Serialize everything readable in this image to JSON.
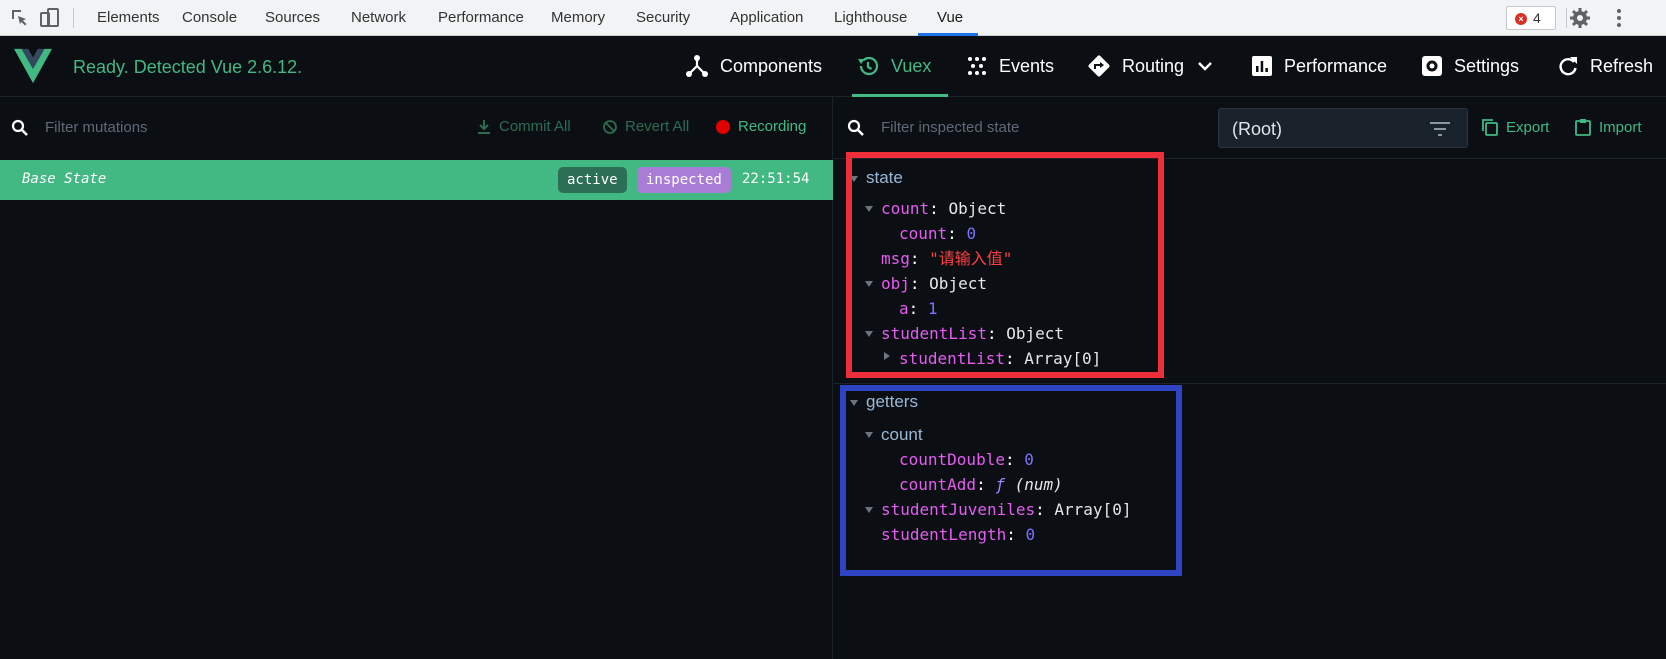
{
  "devtools": {
    "tabs": [
      "Elements",
      "Console",
      "Sources",
      "Network",
      "Performance",
      "Memory",
      "Security",
      "Application",
      "Lighthouse",
      "Vue"
    ],
    "active_tab": "Vue",
    "error_count": "4"
  },
  "vue_header": {
    "status": "Ready. Detected Vue 2.6.12.",
    "nav": {
      "components": "Components",
      "vuex": "Vuex",
      "events": "Events",
      "routing": "Routing",
      "performance": "Performance",
      "settings": "Settings",
      "refresh": "Refresh"
    },
    "active_nav": "Vuex"
  },
  "left_pane": {
    "filter_placeholder": "Filter mutations",
    "commit_all": "Commit All",
    "revert_all": "Revert All",
    "recording": "Recording",
    "rows": [
      {
        "label": "Base State",
        "badges": [
          "active",
          "inspected"
        ],
        "time": "22:51:54"
      }
    ]
  },
  "right_pane": {
    "filter_placeholder": "Filter inspected state",
    "root_select": "(Root)",
    "export": "Export",
    "import": "Import",
    "state": {
      "title": "state",
      "lines": [
        {
          "key": "count",
          "value": "Object"
        },
        {
          "key": "count",
          "value": "0"
        },
        {
          "key": "msg",
          "value": "\"请输入值\""
        },
        {
          "key": "obj",
          "value": "Object"
        },
        {
          "key": "a",
          "value": "1"
        },
        {
          "key": "studentList",
          "value": "Object"
        },
        {
          "key": "studentList",
          "value": "Array[0]"
        }
      ]
    },
    "getters": {
      "title": "getters",
      "group": "count",
      "lines": [
        {
          "key": "countDouble",
          "value": "0"
        },
        {
          "key": "countAdd",
          "fn_symbol": "ƒ",
          "value": "(num)"
        },
        {
          "key": "studentJuveniles",
          "value": "Array[0]"
        },
        {
          "key": "studentLength",
          "value": "0"
        }
      ]
    }
  },
  "colors": {
    "vue_green": "#42b883",
    "background": "#0b0f14",
    "highlight_red": "#ee2f3a",
    "highlight_blue": "#2f44c4"
  }
}
